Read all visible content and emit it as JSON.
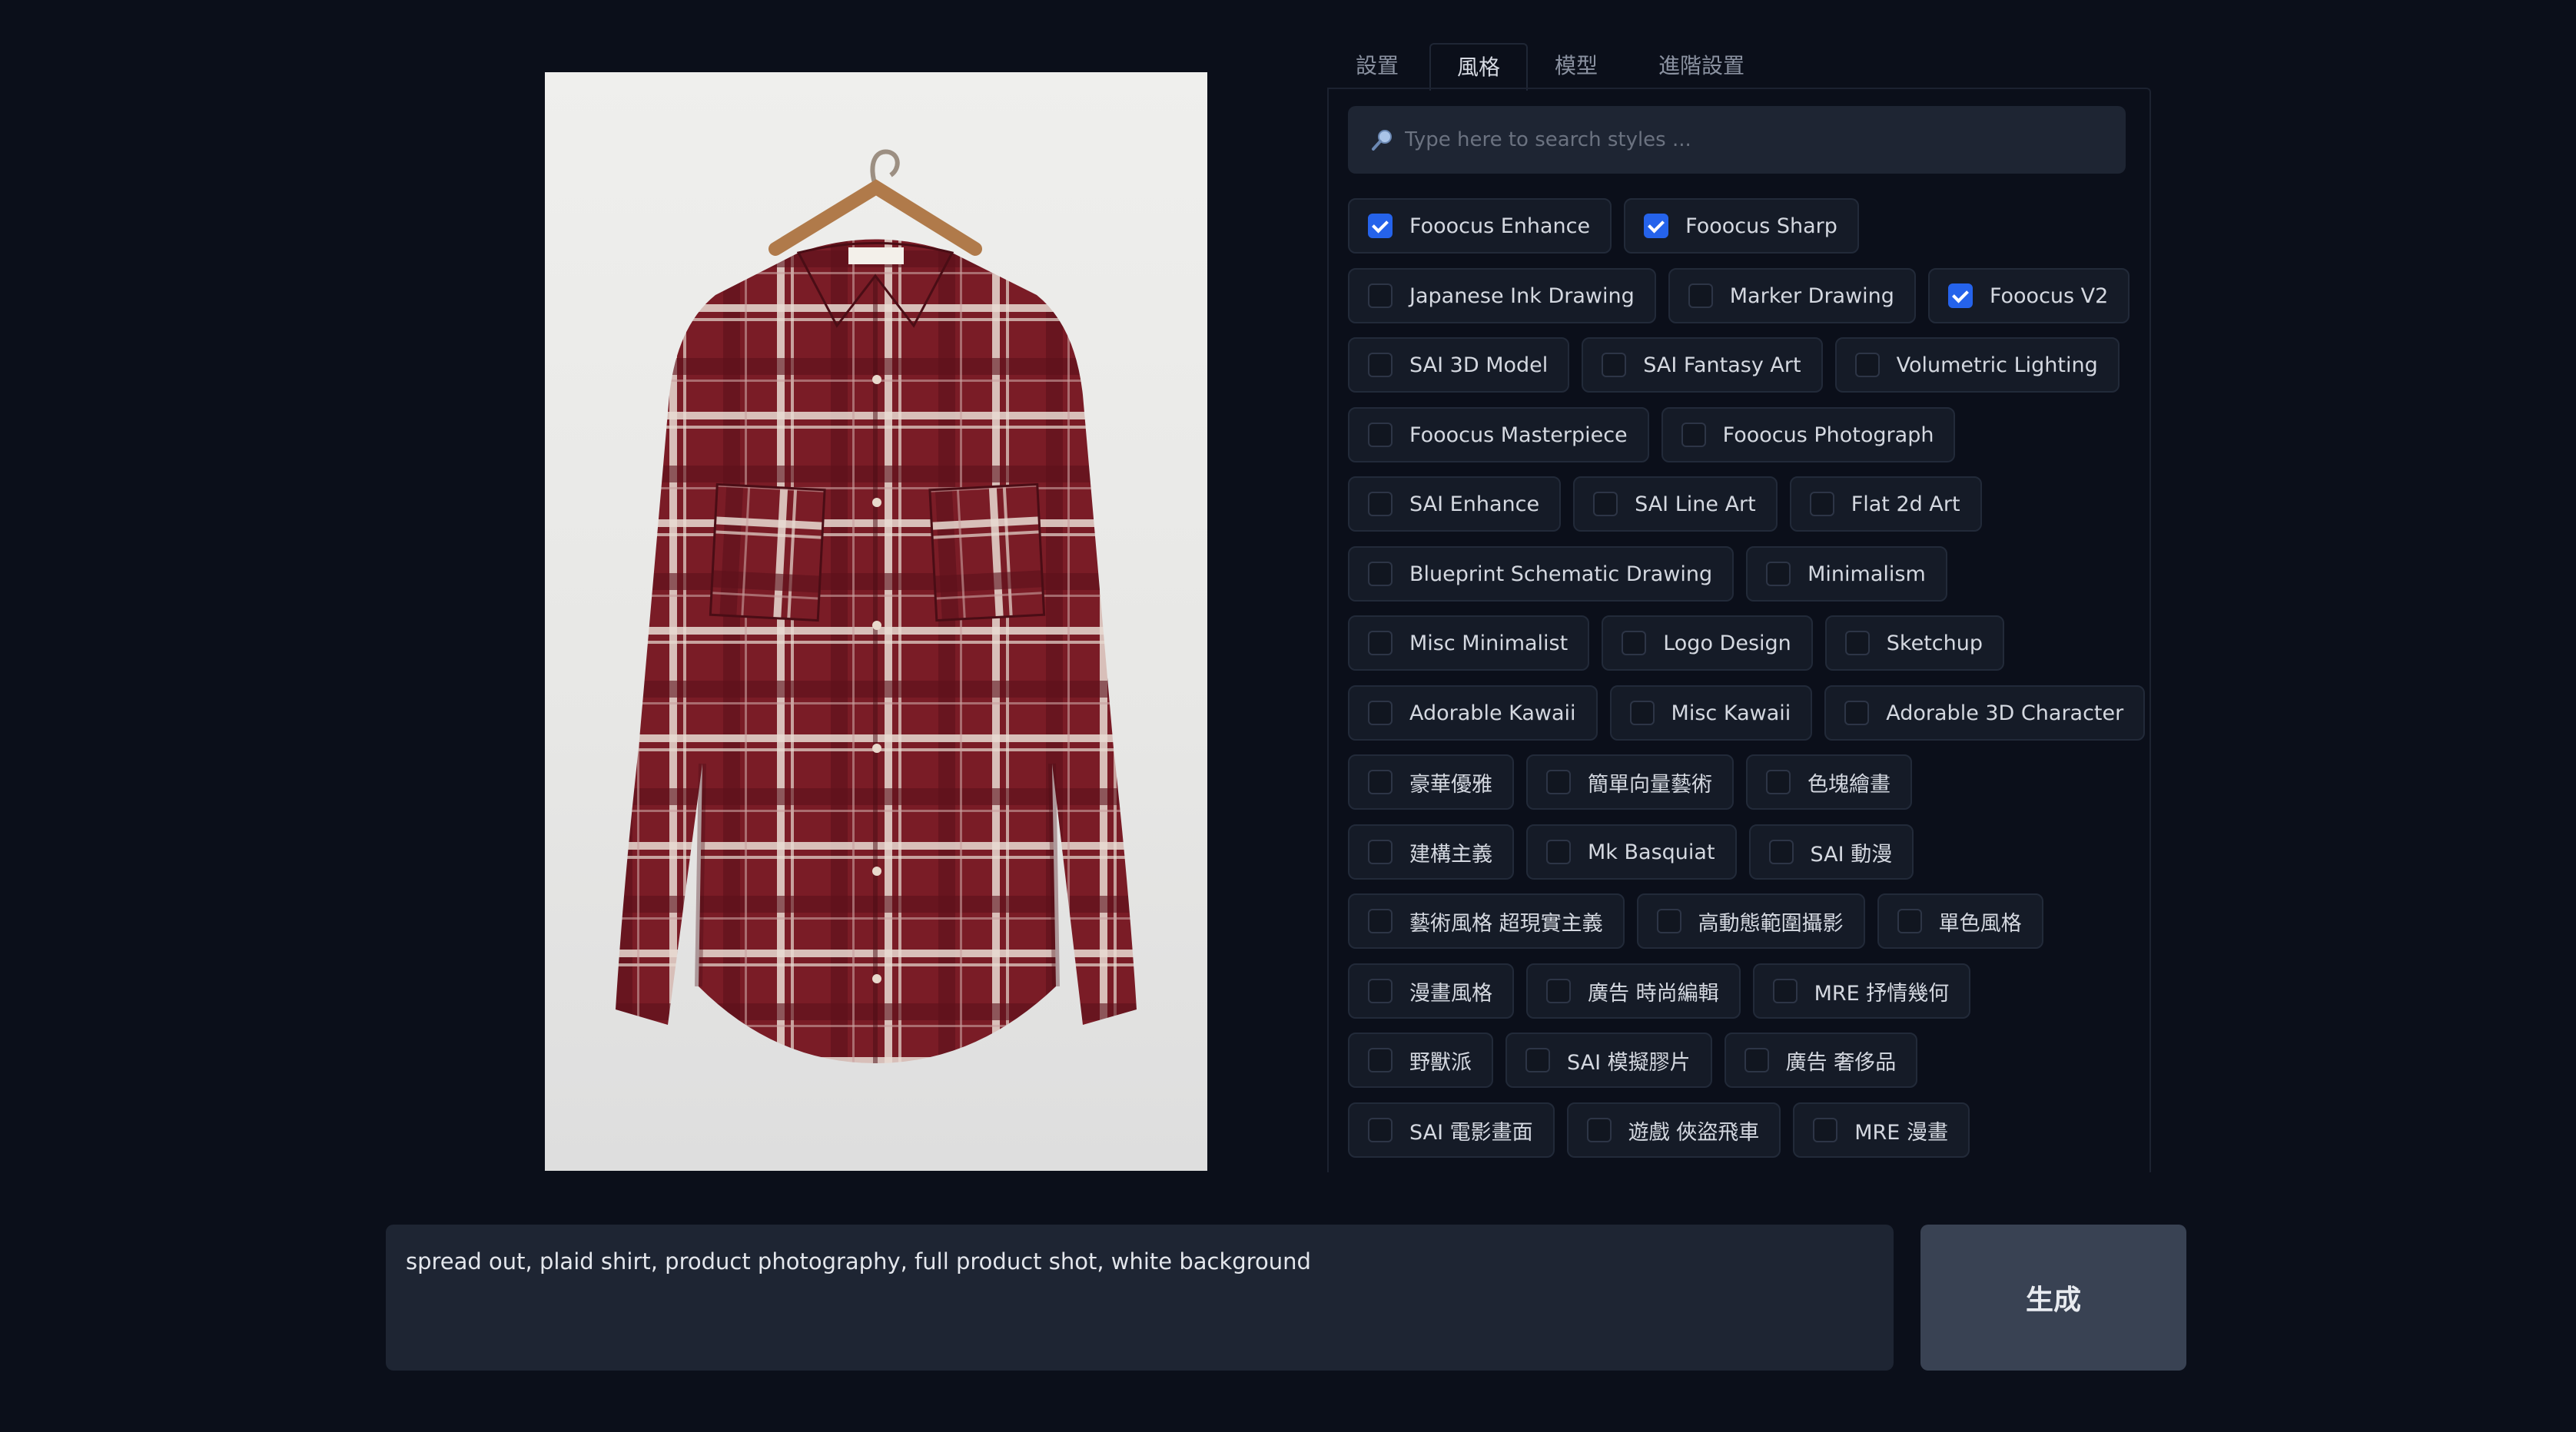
{
  "tabs": [
    {
      "label": "設置",
      "active": false
    },
    {
      "label": "風格",
      "active": true
    },
    {
      "label": "模型",
      "active": false
    },
    {
      "label": "進階設置",
      "active": false
    }
  ],
  "search": {
    "icon": "search-icon",
    "placeholder": "Type here to search styles ..."
  },
  "styles": [
    [
      "Fooocus Enhance",
      "Fooocus Sharp"
    ],
    [
      "Japanese Ink Drawing",
      "Marker Drawing",
      "Fooocus V2"
    ],
    [
      "SAI 3D Model",
      "SAI Fantasy Art",
      "Volumetric Lighting"
    ],
    [
      "Fooocus Masterpiece",
      "Fooocus Photograph"
    ],
    [
      "SAI Enhance",
      "SAI Line Art",
      "Flat 2d Art"
    ],
    [
      "Blueprint Schematic Drawing",
      "Minimalism"
    ],
    [
      "Misc Minimalist",
      "Logo Design",
      "Sketchup"
    ],
    [
      "Adorable Kawaii",
      "Misc Kawaii",
      "Adorable 3D Character"
    ],
    [
      "豪華優雅",
      "簡單向量藝術",
      "色塊繪畫"
    ],
    [
      "建構主義",
      "Mk Basquiat",
      "SAI 動漫"
    ],
    [
      "藝術風格 超現實主義",
      "高動態範圍攝影",
      "單色風格"
    ],
    [
      "漫畫風格",
      "廣告 時尚編輯",
      "MRE 抒情幾何"
    ],
    [
      "野獸派",
      "SAI 模擬膠片",
      "廣告 奢侈品"
    ],
    [
      "SAI 電影畫面",
      "遊戲 俠盜飛車",
      "MRE 漫畫"
    ]
  ],
  "checked_styles": [
    "Fooocus Enhance",
    "Fooocus Sharp",
    "Fooocus V2"
  ],
  "prompt": {
    "value": "spread out, plaid shirt, product photography, full product shot, white background"
  },
  "generate": {
    "label": "生成"
  },
  "colors": {
    "background": "#0b0f1a",
    "accent": "#2563eb",
    "input_bg": "#1e2533",
    "button_bg": "#394253",
    "shirt": "#7a1c26"
  }
}
